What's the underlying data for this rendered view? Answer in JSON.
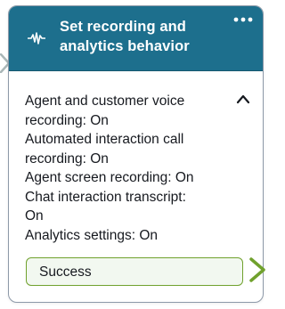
{
  "block": {
    "title_line1": "Set recording and",
    "title_line2": "analytics behavior",
    "header_color": "#1d6f8d",
    "icon": "audio-waveform-icon",
    "more_icon": "more-options-icon",
    "collapse_icon": "chevron-up-icon",
    "details": [
      "Agent and customer voice",
      "recording: On",
      "Automated interaction call",
      "recording: On",
      "Agent screen recording: On",
      "Chat interaction transcript:",
      "On",
      "Analytics settings: On"
    ]
  },
  "branches": [
    {
      "label": "Success",
      "color": "#70a12d",
      "icon": "chevron-right-icon"
    }
  ]
}
